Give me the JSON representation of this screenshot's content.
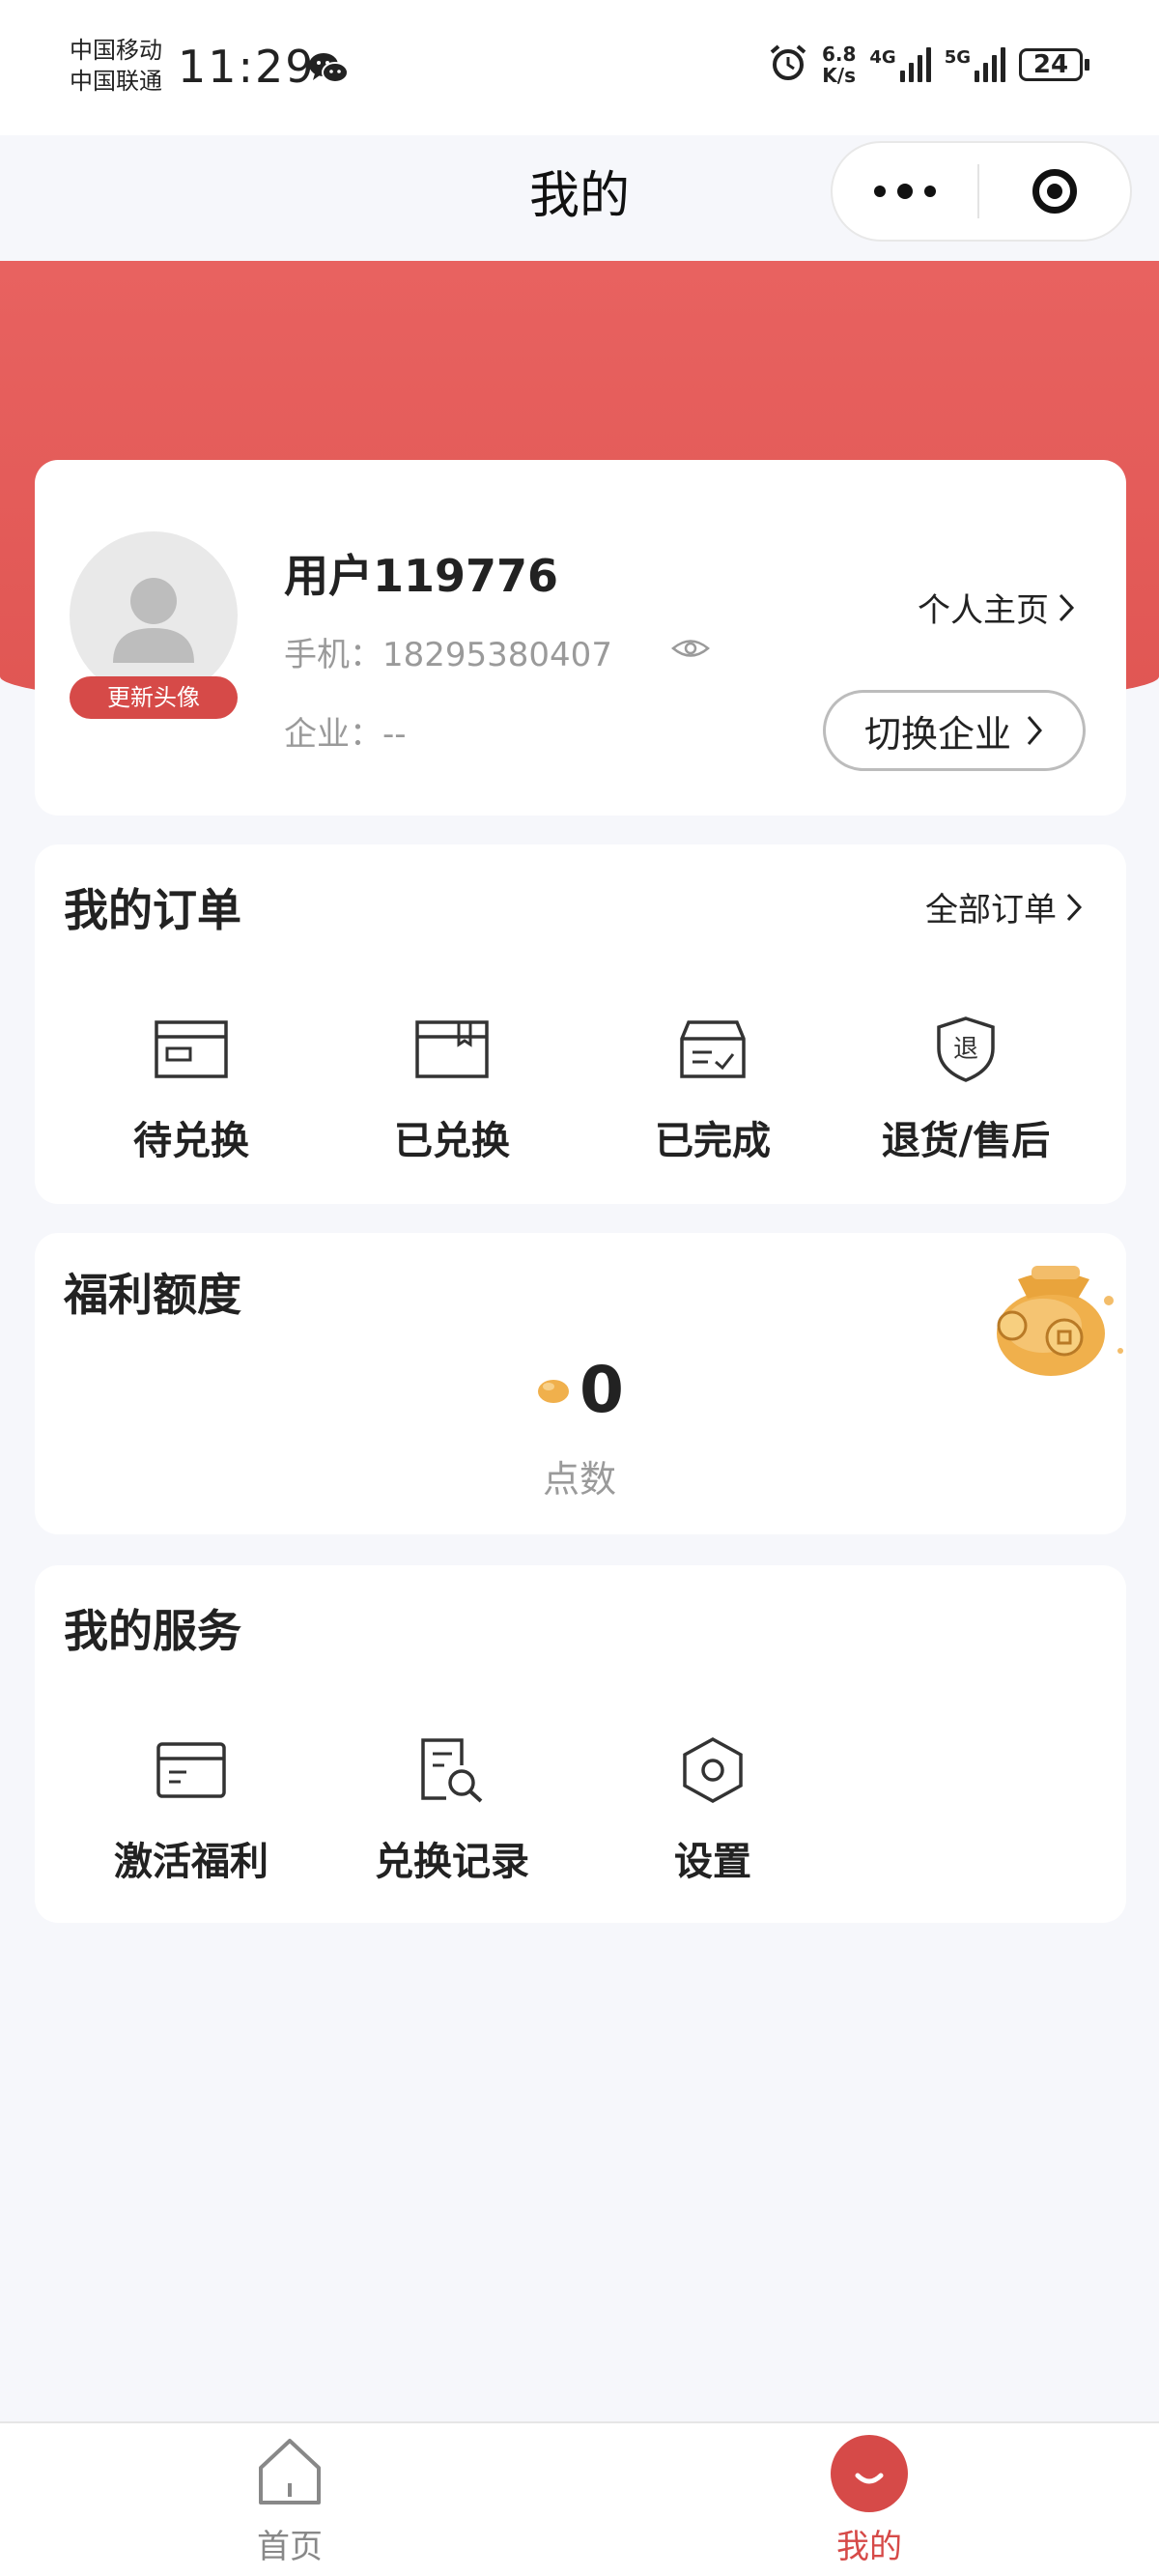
{
  "status_bar": {
    "carrier_1": "中国移动",
    "carrier_2": "中国联通",
    "time": "11:29",
    "net_speed_value": "6.8",
    "net_speed_unit": "K/s",
    "signal_1": "4G",
    "signal_2": "5G",
    "battery": "24"
  },
  "header": {
    "title": "我的"
  },
  "profile": {
    "username": "用户119776",
    "phone_label": "手机：",
    "phone": "18295380407",
    "company_label": "企业：",
    "company": "--",
    "avatar_badge": "更新头像",
    "homepage_link": "个人主页",
    "switch_company": "切换企业"
  },
  "orders": {
    "title": "我的订单",
    "all_link": "全部订单",
    "items": [
      {
        "label": "待兑换",
        "icon": "card-icon"
      },
      {
        "label": "已兑换",
        "icon": "box-icon"
      },
      {
        "label": "已完成",
        "icon": "done-box-icon"
      },
      {
        "label": "退货/售后",
        "icon": "return-shield-icon",
        "icon_text": "退"
      }
    ]
  },
  "welfare": {
    "title": "福利额度",
    "value": "0",
    "unit": "点数"
  },
  "services": {
    "title": "我的服务",
    "items": [
      {
        "label": "激活福利",
        "icon": "card-activate-icon"
      },
      {
        "label": "兑换记录",
        "icon": "record-search-icon"
      },
      {
        "label": "设置",
        "icon": "settings-hex-icon"
      }
    ]
  },
  "tabbar": {
    "items": [
      {
        "label": "首页",
        "icon": "home-icon",
        "active": false
      },
      {
        "label": "我的",
        "icon": "smile-icon",
        "active": true
      }
    ],
    "active_color": "#d64a48",
    "inactive_color": "#888888"
  },
  "colors": {
    "brand_red": "#e05653",
    "badge_red": "#d64a48",
    "page_bg": "#f6f7fb"
  }
}
